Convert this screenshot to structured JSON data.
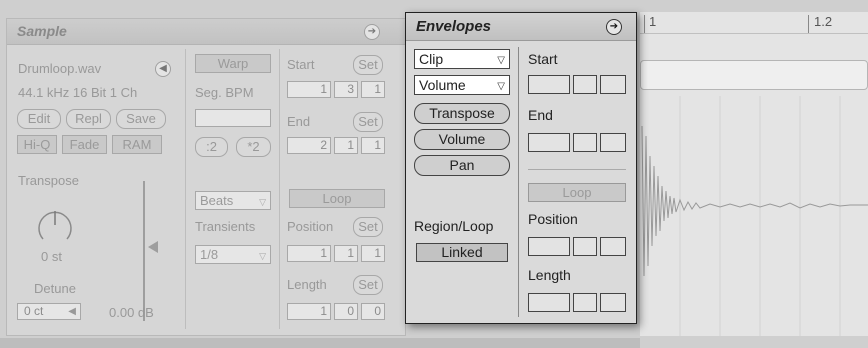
{
  "sample": {
    "title": "Sample",
    "filename": "Drumloop.wav",
    "format": "44.1 kHz 16 Bit 1 Ch",
    "edit": "Edit",
    "repl": "Repl",
    "save": "Save",
    "hiq": "Hi-Q",
    "fade": "Fade",
    "ram": "RAM",
    "transpose_label": "Transpose",
    "transpose_value": "0 st",
    "detune_label": "Detune",
    "detune_value": "0 ct",
    "gain_value": "0.00 dB",
    "warp": "Warp",
    "seg_bpm": "Seg. BPM",
    "half": ":2",
    "double": "*2",
    "warp_mode": "Beats",
    "transients": "Transients",
    "transients_value": "1/8",
    "start": "Start",
    "end": "End",
    "set": "Set",
    "start_vals": [
      "1",
      "3",
      "1"
    ],
    "end_vals": [
      "2",
      "1",
      "1"
    ],
    "loop": "Loop",
    "position": "Position",
    "position_vals": [
      "1",
      "1",
      "1"
    ],
    "length": "Length",
    "length_vals": [
      "1",
      "0",
      "0"
    ]
  },
  "envelopes": {
    "title": "Envelopes",
    "device_select": "Clip",
    "control_select": "Volume",
    "transpose": "Transpose",
    "volume": "Volume",
    "pan": "Pan",
    "region_loop": "Region/Loop",
    "linked": "Linked",
    "start": "Start",
    "end": "End",
    "loop": "Loop",
    "position": "Position",
    "length": "Length"
  },
  "ruler": {
    "marks": [
      "1",
      "1.2"
    ]
  }
}
